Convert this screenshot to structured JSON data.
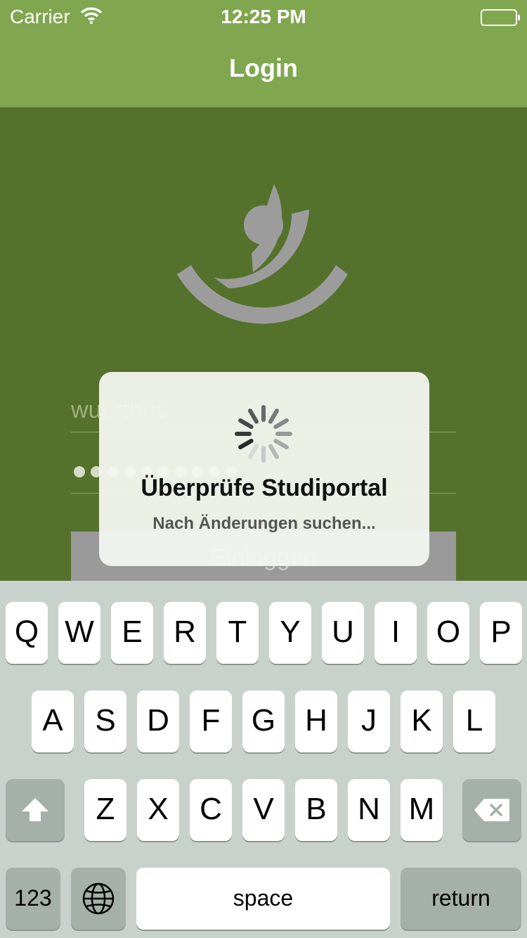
{
  "status_bar": {
    "carrier": "Carrier",
    "time": "12:25 PM"
  },
  "nav": {
    "title": "Login"
  },
  "form": {
    "username_value": "wuerthnc",
    "password_dots": 10,
    "login_label": "Einloggen"
  },
  "hud": {
    "title": "Überprüfe Studiportal",
    "subtitle": "Nach Änderungen suchen..."
  },
  "keyboard": {
    "row1": [
      "Q",
      "W",
      "E",
      "R",
      "T",
      "Y",
      "U",
      "I",
      "O",
      "P"
    ],
    "row2": [
      "A",
      "S",
      "D",
      "F",
      "G",
      "H",
      "J",
      "K",
      "L"
    ],
    "row3": [
      "Z",
      "X",
      "C",
      "V",
      "B",
      "N",
      "M"
    ],
    "numbers_label": "123",
    "space_label": "space",
    "return_label": "return",
    "icons": {
      "shift": "shift-icon",
      "delete": "delete-icon",
      "globe": "globe-icon"
    }
  },
  "colors": {
    "bar": "#80a64f",
    "background": "#55722c",
    "logo": "#9c9c9c"
  }
}
